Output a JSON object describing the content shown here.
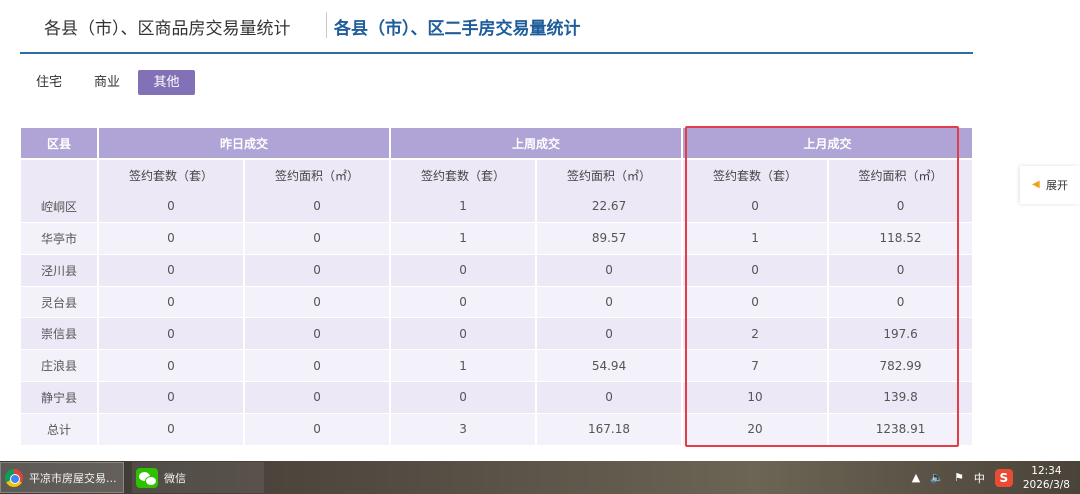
{
  "header": {
    "tab_inactive": "各县（市）、区商品房交易量统计",
    "tab_active": "各县（市）、区二手房交易量统计"
  },
  "subtabs": [
    "住宅",
    "商业",
    "其他"
  ],
  "active_subtab": "其他",
  "table": {
    "group_headers": [
      "区县",
      "昨日成交",
      "上周成交",
      "上月成交"
    ],
    "sub_headers": [
      "签约套数（套）",
      "签约面积（㎡）",
      "签约套数（套）",
      "签约面积（㎡）",
      "签约套数（套）",
      "签约面积（㎡）"
    ],
    "rows": [
      [
        "崆峒区",
        "0",
        "0",
        "1",
        "22.67",
        "0",
        "0"
      ],
      [
        "华亭市",
        "0",
        "0",
        "1",
        "89.57",
        "1",
        "118.52"
      ],
      [
        "泾川县",
        "0",
        "0",
        "0",
        "0",
        "0",
        "0"
      ],
      [
        "灵台县",
        "0",
        "0",
        "0",
        "0",
        "0",
        "0"
      ],
      [
        "崇信县",
        "0",
        "0",
        "0",
        "0",
        "2",
        "197.6"
      ],
      [
        "庄浪县",
        "0",
        "0",
        "1",
        "54.94",
        "7",
        "782.99"
      ],
      [
        "静宁县",
        "0",
        "0",
        "0",
        "0",
        "10",
        "139.8"
      ],
      [
        "总计",
        "0",
        "0",
        "3",
        "167.18",
        "20",
        "1238.91"
      ]
    ]
  },
  "side_panel": {
    "expand_label": "展开",
    "icon": "speaker-icon"
  },
  "taskbar": {
    "app1_label": "平凉市房屋交易...",
    "app1_icon": "chrome-icon",
    "app2_label": "微信",
    "app2_icon": "wechat-icon",
    "ime_label": "中",
    "time": "12:34",
    "date": "2026/3/8"
  },
  "colors": {
    "accent": "#8271b6",
    "header_row": "#b0a3d6",
    "cell_bg": "#ece8f6",
    "highlight_box": "#e33d4b",
    "title_blue": "#1f5d9a"
  }
}
